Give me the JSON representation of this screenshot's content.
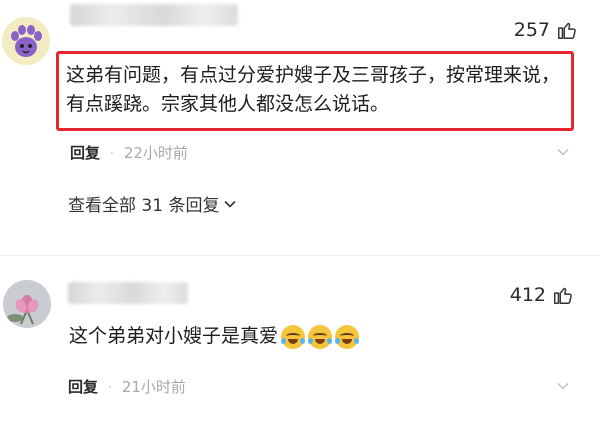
{
  "comments": [
    {
      "likes": "257",
      "text": "这弟有问题，有点过分爱护嫂子及三哥孩子，按常理来说，有点蹊跷。宗家其他人都没怎么说话。",
      "reply_label": "回复",
      "separator": "·",
      "time": "22小时前",
      "view_all": "查看全部 31 条回复"
    },
    {
      "likes": "412",
      "text": "这个弟弟对小嫂子是真爱",
      "reply_label": "回复",
      "separator": "·",
      "time": "21小时前"
    }
  ],
  "colors": {
    "highlight_border": "#e5262f",
    "time_text": "#a9a9a9"
  },
  "icons": [
    "avatar-purple-paw",
    "avatar-lotus",
    "thumbs-up-icon",
    "crying-laughing-emoji",
    "chevron-down-icon"
  ]
}
